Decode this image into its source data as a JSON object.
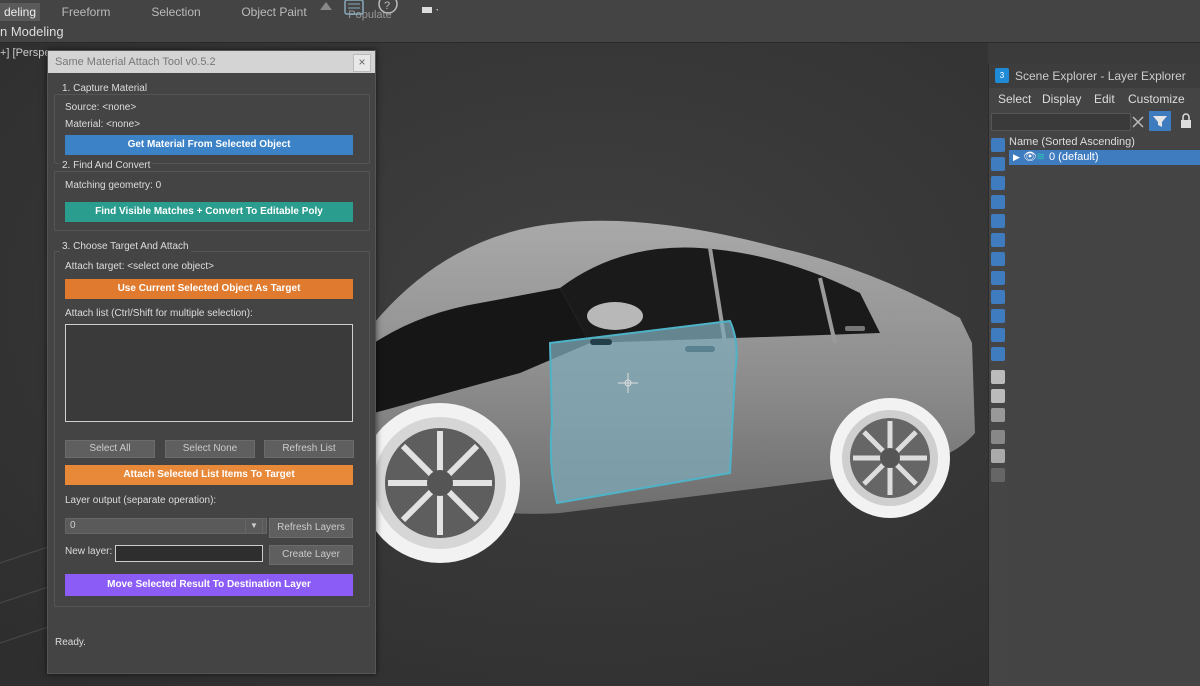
{
  "ribbon": {
    "tabs": [
      {
        "label": "deling",
        "active": true
      },
      {
        "label": "Freeform",
        "active": false
      },
      {
        "label": "Selection",
        "active": false
      },
      {
        "label": "Object Paint",
        "active": false
      },
      {
        "label": "Populate",
        "active": false
      }
    ],
    "row_label": "n Modeling"
  },
  "viewport": {
    "label": "+] [Perspe"
  },
  "tool": {
    "title": "Same Material Attach Tool v0.5.2",
    "close_glyph": "×",
    "section1": {
      "title": "1. Capture Material",
      "source": "Source: <none>",
      "material": "Material: <none>",
      "button": "Get Material From Selected Object"
    },
    "section2": {
      "title": "2. Find And Convert",
      "matching": "Matching geometry: 0",
      "button": "Find Visible Matches + Convert To Editable Poly"
    },
    "section3": {
      "title": "3. Choose Target And Attach",
      "attach_target": "Attach target: <select one object>",
      "target_button": "Use Current Selected Object As Target",
      "list_label": "Attach list (Ctrl/Shift for multiple selection):",
      "select_all": "Select All",
      "select_none": "Select None",
      "refresh_list": "Refresh List",
      "attach_button": "Attach Selected List Items To Target",
      "layer_output_label": "Layer output (separate operation):",
      "layer_combo_value": "0",
      "refresh_layers": "Refresh Layers",
      "new_layer_label": "New layer:",
      "new_layer_value": "",
      "create_layer": "Create Layer",
      "move_button": "Move Selected Result To Destination Layer"
    },
    "status": "Ready."
  },
  "scene_explorer": {
    "icon_text": "3",
    "title": "Scene Explorer - Layer Explorer",
    "menu": [
      "Select",
      "Display",
      "Edit",
      "Customize"
    ],
    "column_header": "Name (Sorted Ascending)",
    "layer_row": "0 (default)"
  },
  "colors": {
    "blue_button": "#3b82c7",
    "teal_button": "#2a9d8f",
    "orange_button": "#e07a2e",
    "orange_button_2": "#e8893a",
    "purple_button": "#8b5cf6",
    "selection_blue": "#3f7cbf",
    "door_highlight": "#4fb3c8"
  }
}
